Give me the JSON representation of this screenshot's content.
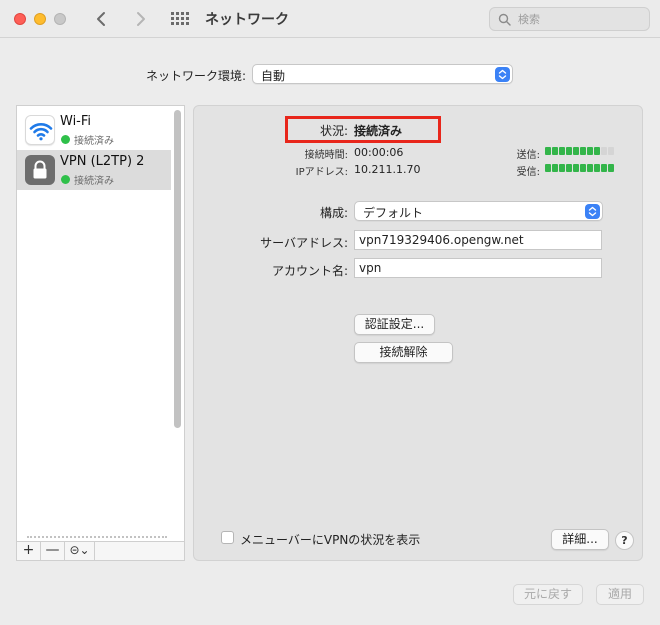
{
  "window": {
    "title": "ネットワーク"
  },
  "search": {
    "placeholder": "検索"
  },
  "location": {
    "label": "ネットワーク環境:",
    "value": "自動"
  },
  "services": [
    {
      "name": "Wi-Fi",
      "status": "接続済み"
    },
    {
      "name": "VPN (L2TP) 2",
      "status": "接続済み"
    }
  ],
  "sidebar_tools": {
    "add": "+",
    "remove": "—",
    "action": "⊝⌄"
  },
  "detail": {
    "status_label": "状況:",
    "status_value": "接続済み",
    "connect_time_label": "接続時間:",
    "connect_time_value": "00:00:06",
    "ip_label": "IPアドレス:",
    "ip_value": "10.211.1.70",
    "sent_label": "送信:",
    "recv_label": "受信:",
    "sent_level": 0.75,
    "recv_level": 1.0,
    "config_label": "構成:",
    "config_value": "デフォルト",
    "server_label": "サーバアドレス:",
    "server_value": "vpn719329406.opengw.net",
    "account_label": "アカウント名:",
    "account_value": "vpn",
    "auth_button": "認証設定...",
    "disconnect_button": "接続解除",
    "menubar_checkbox": "メニューバーにVPNの状況を表示",
    "advanced_button": "詳細...",
    "help": "?"
  },
  "footer": {
    "revert": "元に戻す",
    "apply": "適用"
  },
  "colors": {
    "highlight_border": "#e8261b",
    "status_green": "#2fc04a",
    "accent": "#3b82f6"
  }
}
